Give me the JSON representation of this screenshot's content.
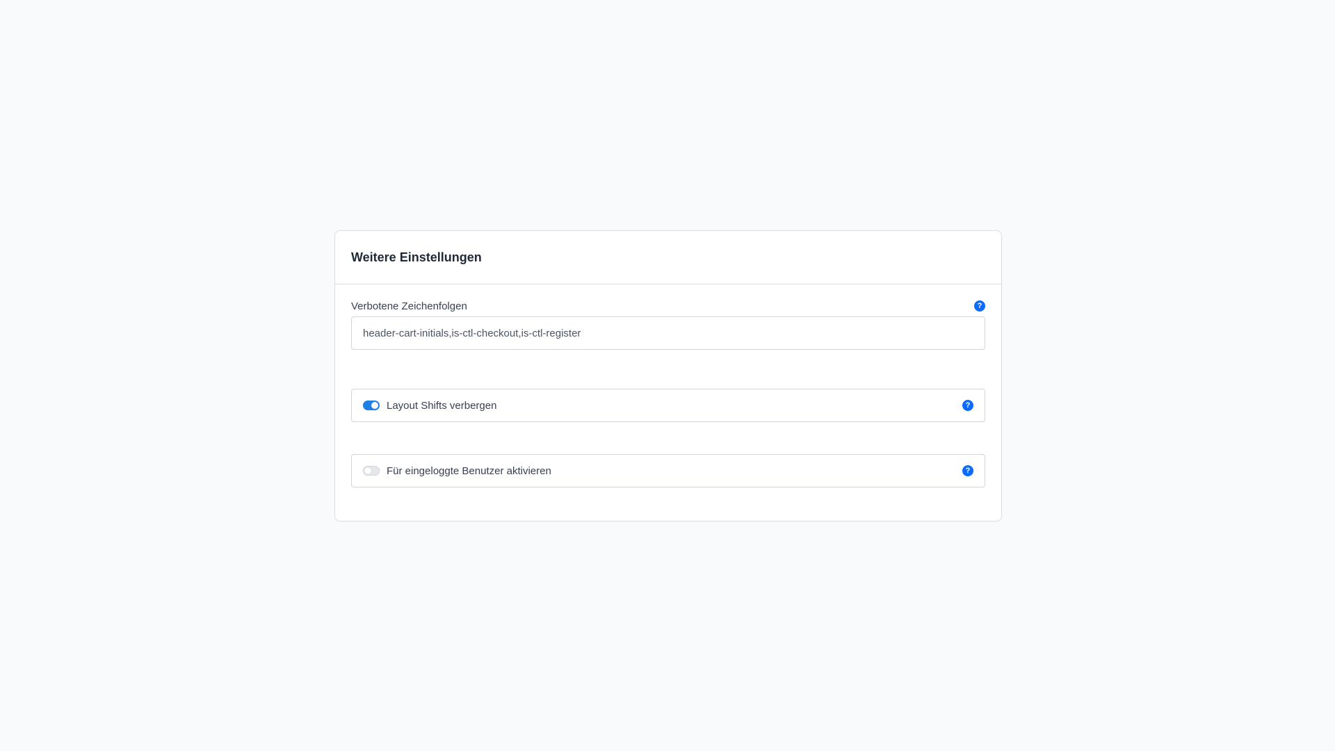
{
  "card": {
    "title": "Weitere Einstellungen"
  },
  "forbidden_strings": {
    "label": "Verbotene Zeichenfolgen",
    "value": "header-cart-initials,is-ctl-checkout,is-ctl-register",
    "help_icon": "question-icon"
  },
  "toggles": [
    {
      "label": "Layout Shifts verbergen",
      "checked": true,
      "help_icon": "question-icon"
    },
    {
      "label": "Für eingeloggte Benutzer aktivieren",
      "checked": false,
      "help_icon": "question-icon"
    }
  ],
  "colors": {
    "accent": "#0b6bff",
    "switch_on": "#1e7fe6",
    "background": "#f9fafb",
    "border": "#d9dce1"
  },
  "icons": {
    "help_glyph": "?"
  }
}
